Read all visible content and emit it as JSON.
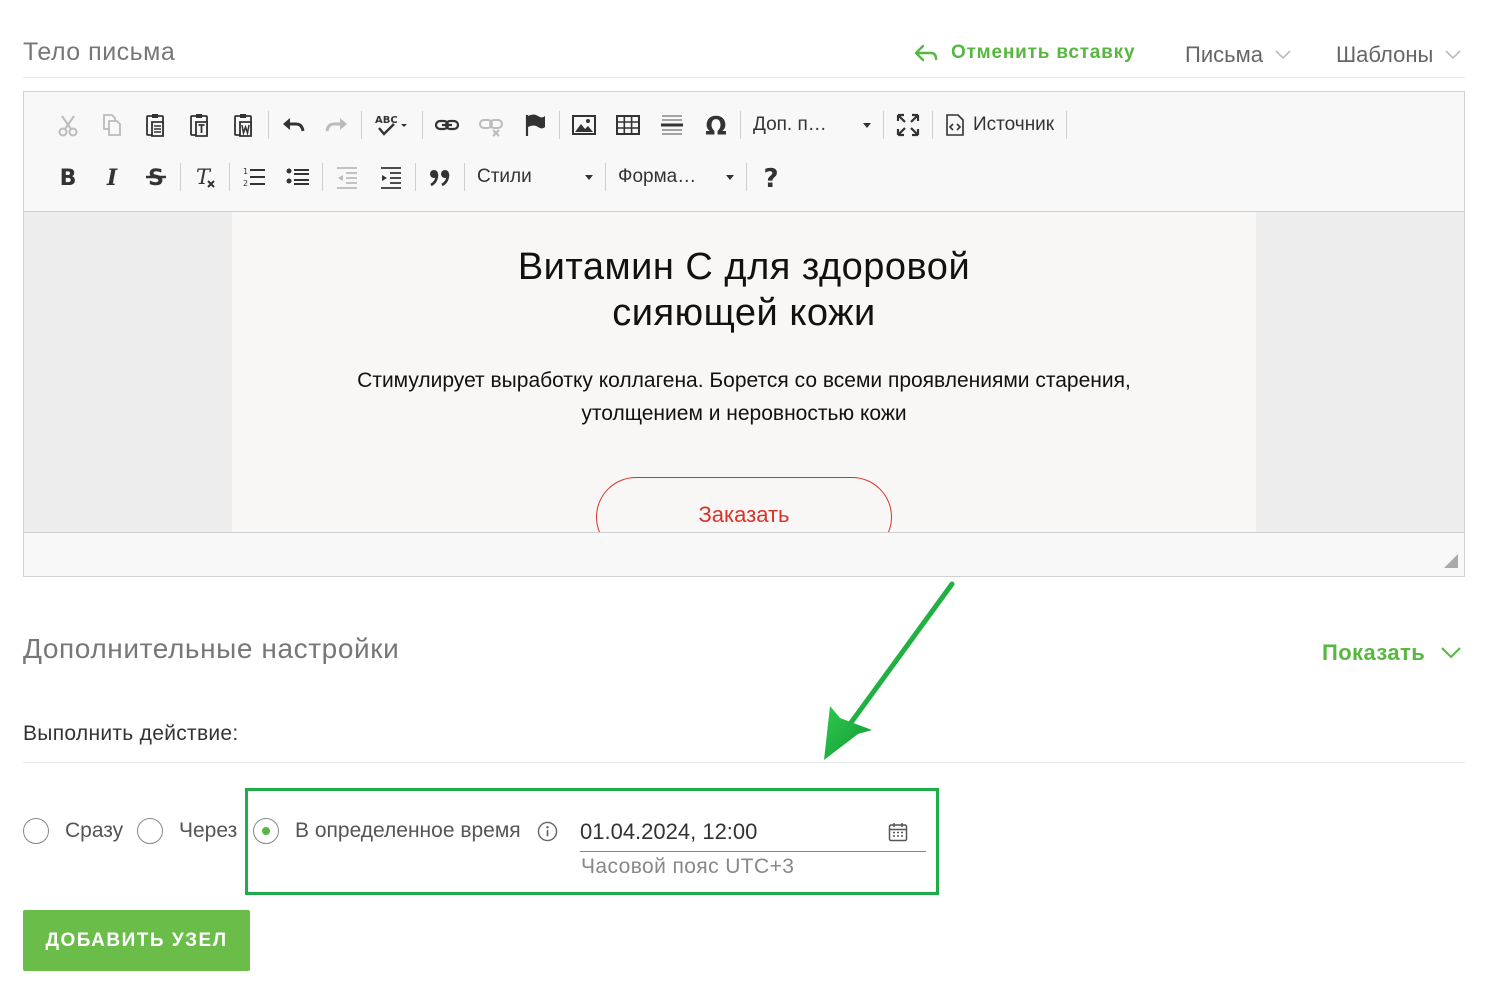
{
  "header": {
    "title": "Тело письма",
    "undo_paste": "Отменить вставку",
    "letters": "Письма",
    "templates": "Шаблоны"
  },
  "toolbar": {
    "extra_plugins": "Доп. п…",
    "source": "Источник",
    "styles": "Стили",
    "format": "Форма…"
  },
  "email": {
    "title_line1": "Витамин С для здоровой",
    "title_line2": "сияющей кожи",
    "subtitle_line1": "Стимулирует выработку коллагена. Борется со всеми проявлениями старения,",
    "subtitle_line2": "утолщением и неровностью кожи",
    "button": "Заказать"
  },
  "advanced": {
    "title": "Дополнительные настройки",
    "show": "Показать"
  },
  "action": {
    "label": "Выполнить действие:",
    "options": [
      {
        "label": "Сразу",
        "selected": false
      },
      {
        "label": "Через",
        "selected": false
      },
      {
        "label": "В определенное время",
        "selected": true
      }
    ],
    "datetime": "01.04.2024, 12:00",
    "timezone": "Часовой пояс UTC+3"
  },
  "add_node_button": "ДОБАВИТЬ УЗЕЛ",
  "colors": {
    "accent": "#58b741",
    "button_bg": "#6bbd4a",
    "highlight": "#1ead48",
    "email_button": "#d9322b"
  }
}
